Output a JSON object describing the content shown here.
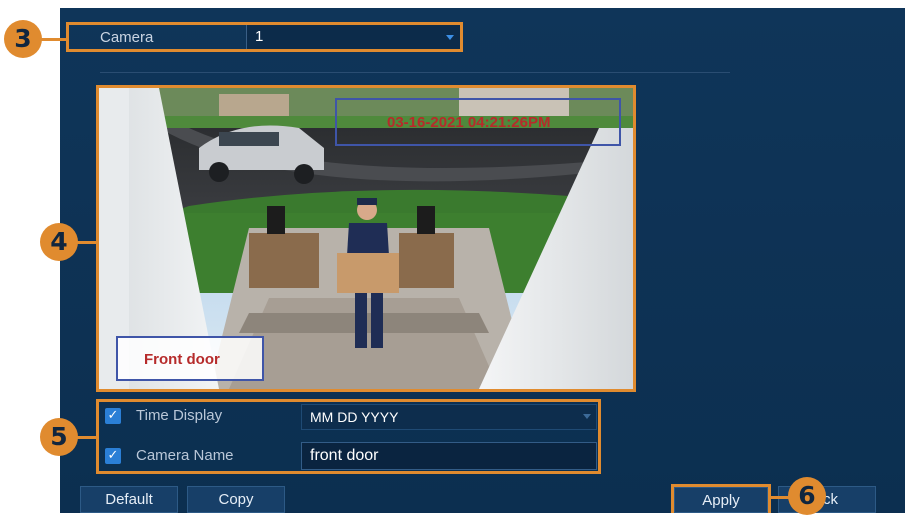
{
  "colors": {
    "accent_orange": "#e08b2f",
    "panel_blue": "#0f3559",
    "highlight_blue": "#3f55a8",
    "osd_red": "#b62b2b"
  },
  "callouts": {
    "camera": "3",
    "preview": "4",
    "options": "5",
    "apply": "6"
  },
  "camera_selector": {
    "label": "Camera",
    "value": "1"
  },
  "preview": {
    "timestamp": "03-16-2021 04:21:26PM",
    "camera_name_overlay": "Front door"
  },
  "options": {
    "time_display": {
      "label": "Time Display",
      "checked": true,
      "value": "MM DD YYYY"
    },
    "camera_name": {
      "label": "Camera Name",
      "checked": true,
      "value": "front door"
    }
  },
  "buttons": {
    "default": "Default",
    "copy": "Copy",
    "apply": "Apply",
    "back": "ck"
  },
  "icons": {
    "check": "check-icon",
    "dropdown": "chevron-down-icon"
  }
}
